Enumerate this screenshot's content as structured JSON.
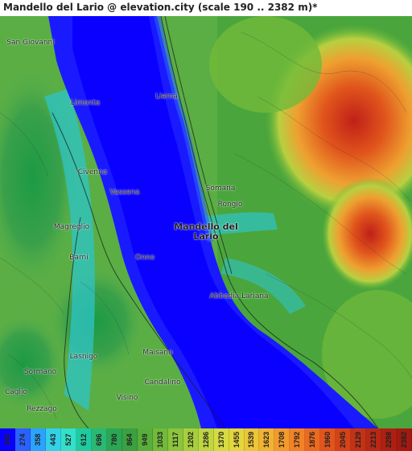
{
  "title": "Mandello del Lario @ elevation.city (scale 190 .. 2382 m)*",
  "places": [
    {
      "name": "San Giovanni",
      "major": false
    },
    {
      "name": "Lierna",
      "major": false
    },
    {
      "name": "Limonta",
      "major": false
    },
    {
      "name": "Civenna",
      "major": false
    },
    {
      "name": "Vassena",
      "major": false
    },
    {
      "name": "Somana",
      "major": false
    },
    {
      "name": "Rongio",
      "major": false
    },
    {
      "name": "Mandello del Lario",
      "major": true
    },
    {
      "name": "Magreglio",
      "major": false
    },
    {
      "name": "Barni",
      "major": false
    },
    {
      "name": "Onno",
      "major": false
    },
    {
      "name": "Abbadia Lariana",
      "major": false
    },
    {
      "name": "Lasnigo",
      "major": false
    },
    {
      "name": "Maisano",
      "major": false
    },
    {
      "name": "Sormano",
      "major": false
    },
    {
      "name": "Candalino",
      "major": false
    },
    {
      "name": "Caglio",
      "major": false
    },
    {
      "name": "Visino",
      "major": false
    },
    {
      "name": "Rezzago",
      "major": false
    }
  ],
  "scale": {
    "values": [
      "190",
      "274",
      "358",
      "443",
      "527",
      "612",
      "696",
      "780",
      "864",
      "949",
      "1033",
      "1117",
      "1202",
      "1286",
      "1370",
      "1455",
      "1539",
      "1623",
      "1708",
      "1792",
      "1876",
      "1960",
      "2045",
      "2129",
      "2213",
      "2298",
      "2382"
    ],
    "colors": [
      "#0a00ff",
      "#2a62ff",
      "#2aa3ff",
      "#33d1e8",
      "#33e0c8",
      "#1ecba0",
      "#2ab872",
      "#2aa654",
      "#3aa040",
      "#58ae3a",
      "#72ba3a",
      "#8cc43c",
      "#a6ce3e",
      "#c0d640",
      "#d6dc40",
      "#e4d63c",
      "#ecc638",
      "#f2b232",
      "#f49a2c",
      "#f28226",
      "#ec6a20",
      "#e2541c",
      "#d44218",
      "#c43216",
      "#b82814",
      "#ae2012",
      "#a41a10"
    ]
  }
}
